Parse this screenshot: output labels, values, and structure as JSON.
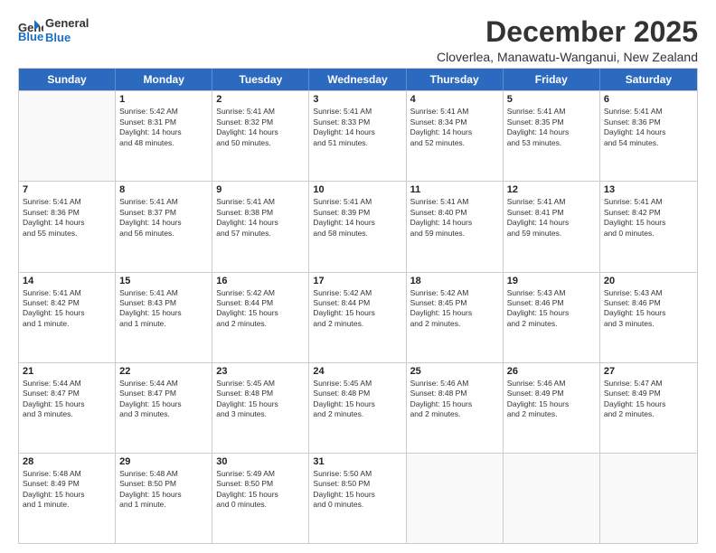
{
  "header": {
    "logo_line1": "General",
    "logo_line2": "Blue",
    "month": "December 2025",
    "location": "Cloverlea, Manawatu-Wanganui, New Zealand"
  },
  "weekdays": [
    "Sunday",
    "Monday",
    "Tuesday",
    "Wednesday",
    "Thursday",
    "Friday",
    "Saturday"
  ],
  "rows": [
    [
      {
        "day": "",
        "info": ""
      },
      {
        "day": "1",
        "info": "Sunrise: 5:42 AM\nSunset: 8:31 PM\nDaylight: 14 hours\nand 48 minutes."
      },
      {
        "day": "2",
        "info": "Sunrise: 5:41 AM\nSunset: 8:32 PM\nDaylight: 14 hours\nand 50 minutes."
      },
      {
        "day": "3",
        "info": "Sunrise: 5:41 AM\nSunset: 8:33 PM\nDaylight: 14 hours\nand 51 minutes."
      },
      {
        "day": "4",
        "info": "Sunrise: 5:41 AM\nSunset: 8:34 PM\nDaylight: 14 hours\nand 52 minutes."
      },
      {
        "day": "5",
        "info": "Sunrise: 5:41 AM\nSunset: 8:35 PM\nDaylight: 14 hours\nand 53 minutes."
      },
      {
        "day": "6",
        "info": "Sunrise: 5:41 AM\nSunset: 8:36 PM\nDaylight: 14 hours\nand 54 minutes."
      }
    ],
    [
      {
        "day": "7",
        "info": "Sunrise: 5:41 AM\nSunset: 8:36 PM\nDaylight: 14 hours\nand 55 minutes."
      },
      {
        "day": "8",
        "info": "Sunrise: 5:41 AM\nSunset: 8:37 PM\nDaylight: 14 hours\nand 56 minutes."
      },
      {
        "day": "9",
        "info": "Sunrise: 5:41 AM\nSunset: 8:38 PM\nDaylight: 14 hours\nand 57 minutes."
      },
      {
        "day": "10",
        "info": "Sunrise: 5:41 AM\nSunset: 8:39 PM\nDaylight: 14 hours\nand 58 minutes."
      },
      {
        "day": "11",
        "info": "Sunrise: 5:41 AM\nSunset: 8:40 PM\nDaylight: 14 hours\nand 59 minutes."
      },
      {
        "day": "12",
        "info": "Sunrise: 5:41 AM\nSunset: 8:41 PM\nDaylight: 14 hours\nand 59 minutes."
      },
      {
        "day": "13",
        "info": "Sunrise: 5:41 AM\nSunset: 8:42 PM\nDaylight: 15 hours\nand 0 minutes."
      }
    ],
    [
      {
        "day": "14",
        "info": "Sunrise: 5:41 AM\nSunset: 8:42 PM\nDaylight: 15 hours\nand 1 minute."
      },
      {
        "day": "15",
        "info": "Sunrise: 5:41 AM\nSunset: 8:43 PM\nDaylight: 15 hours\nand 1 minute."
      },
      {
        "day": "16",
        "info": "Sunrise: 5:42 AM\nSunset: 8:44 PM\nDaylight: 15 hours\nand 2 minutes."
      },
      {
        "day": "17",
        "info": "Sunrise: 5:42 AM\nSunset: 8:44 PM\nDaylight: 15 hours\nand 2 minutes."
      },
      {
        "day": "18",
        "info": "Sunrise: 5:42 AM\nSunset: 8:45 PM\nDaylight: 15 hours\nand 2 minutes."
      },
      {
        "day": "19",
        "info": "Sunrise: 5:43 AM\nSunset: 8:46 PM\nDaylight: 15 hours\nand 2 minutes."
      },
      {
        "day": "20",
        "info": "Sunrise: 5:43 AM\nSunset: 8:46 PM\nDaylight: 15 hours\nand 3 minutes."
      }
    ],
    [
      {
        "day": "21",
        "info": "Sunrise: 5:44 AM\nSunset: 8:47 PM\nDaylight: 15 hours\nand 3 minutes."
      },
      {
        "day": "22",
        "info": "Sunrise: 5:44 AM\nSunset: 8:47 PM\nDaylight: 15 hours\nand 3 minutes."
      },
      {
        "day": "23",
        "info": "Sunrise: 5:45 AM\nSunset: 8:48 PM\nDaylight: 15 hours\nand 3 minutes."
      },
      {
        "day": "24",
        "info": "Sunrise: 5:45 AM\nSunset: 8:48 PM\nDaylight: 15 hours\nand 2 minutes."
      },
      {
        "day": "25",
        "info": "Sunrise: 5:46 AM\nSunset: 8:48 PM\nDaylight: 15 hours\nand 2 minutes."
      },
      {
        "day": "26",
        "info": "Sunrise: 5:46 AM\nSunset: 8:49 PM\nDaylight: 15 hours\nand 2 minutes."
      },
      {
        "day": "27",
        "info": "Sunrise: 5:47 AM\nSunset: 8:49 PM\nDaylight: 15 hours\nand 2 minutes."
      }
    ],
    [
      {
        "day": "28",
        "info": "Sunrise: 5:48 AM\nSunset: 8:49 PM\nDaylight: 15 hours\nand 1 minute."
      },
      {
        "day": "29",
        "info": "Sunrise: 5:48 AM\nSunset: 8:50 PM\nDaylight: 15 hours\nand 1 minute."
      },
      {
        "day": "30",
        "info": "Sunrise: 5:49 AM\nSunset: 8:50 PM\nDaylight: 15 hours\nand 0 minutes."
      },
      {
        "day": "31",
        "info": "Sunrise: 5:50 AM\nSunset: 8:50 PM\nDaylight: 15 hours\nand 0 minutes."
      },
      {
        "day": "",
        "info": ""
      },
      {
        "day": "",
        "info": ""
      },
      {
        "day": "",
        "info": ""
      }
    ]
  ]
}
